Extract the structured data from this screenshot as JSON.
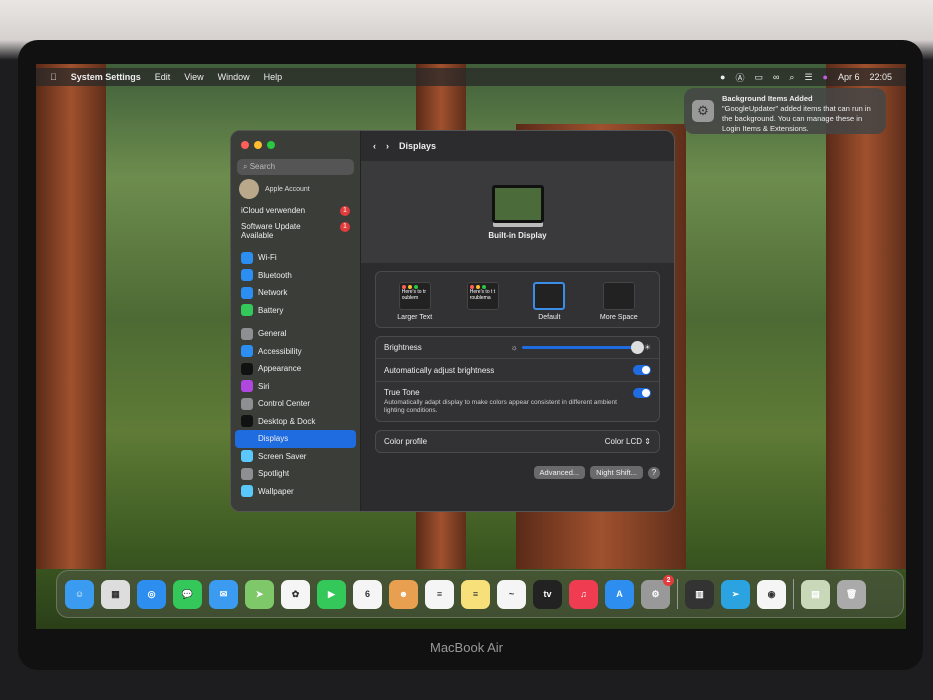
{
  "menubar": {
    "apple_icon": "apple-logo",
    "app": "System Settings",
    "items": [
      "Edit",
      "View",
      "Window",
      "Help"
    ],
    "status_icons": [
      "user-icon",
      "input-a-icon",
      "battery-icon",
      "link-icon",
      "search-icon",
      "control-center-icon",
      "siri-icon"
    ],
    "date": "Apr 6",
    "time": "22:05"
  },
  "notification": {
    "title": "Background Items Added",
    "body": "\"GoogleUpdater\" added items that can run in the background. You can manage these in Login Items & Extensions."
  },
  "sidebar": {
    "search_placeholder": "Search",
    "account_label": "Apple Account",
    "alerts": [
      {
        "label": "iCloud verwenden",
        "badge": "1"
      },
      {
        "label": "Software Update Available",
        "badge": "1"
      }
    ],
    "groups": [
      [
        {
          "label": "Wi-Fi",
          "icon": "wifi-icon",
          "color": "#2b8ef0"
        },
        {
          "label": "Bluetooth",
          "icon": "bluetooth-icon",
          "color": "#2b8ef0"
        },
        {
          "label": "Network",
          "icon": "globe-icon",
          "color": "#2b8ef0"
        },
        {
          "label": "Battery",
          "icon": "battery-icon",
          "color": "#34c759"
        }
      ],
      [
        {
          "label": "General",
          "icon": "gear-icon",
          "color": "#8e8e93"
        },
        {
          "label": "Accessibility",
          "icon": "accessibility-icon",
          "color": "#2b8ef0"
        },
        {
          "label": "Appearance",
          "icon": "appearance-icon",
          "color": "#111111"
        },
        {
          "label": "Siri",
          "icon": "siri-icon",
          "color": "#b048e0"
        },
        {
          "label": "Control Center",
          "icon": "control-center-icon",
          "color": "#8e8e93"
        },
        {
          "label": "Desktop & Dock",
          "icon": "dock-icon",
          "color": "#111111"
        },
        {
          "label": "Displays",
          "icon": "sun-icon",
          "color": "#1f6ce0",
          "selected": true
        },
        {
          "label": "Screen Saver",
          "icon": "screensaver-icon",
          "color": "#5ac8fa"
        },
        {
          "label": "Spotlight",
          "icon": "spotlight-icon",
          "color": "#8e8e93"
        },
        {
          "label": "Wallpaper",
          "icon": "wallpaper-icon",
          "color": "#5ac8fa"
        }
      ]
    ]
  },
  "main": {
    "title": "Displays",
    "display_name": "Built-in Display",
    "resolutions": [
      {
        "label": "Larger Text",
        "preview": "Here's to troublem"
      },
      {
        "label": "",
        "preview": "Here's to t troublema"
      },
      {
        "label": "Default",
        "selected": true,
        "preview": ""
      },
      {
        "label": "More Space",
        "preview": ""
      }
    ],
    "brightness_label": "Brightness",
    "brightness_value": 0.95,
    "auto_brightness_label": "Automatically adjust brightness",
    "auto_brightness_on": true,
    "true_tone_label": "True Tone",
    "true_tone_desc": "Automatically adapt display to make colors appear consistent in different ambient lighting conditions.",
    "true_tone_on": true,
    "color_profile_label": "Color profile",
    "color_profile_value": "Color LCD",
    "advanced_button": "Advanced...",
    "night_shift_button": "Night Shift...",
    "help_button": "?"
  },
  "dock": {
    "apps": [
      {
        "name": "Finder",
        "color": "#3a9bf0",
        "glyph": "☺"
      },
      {
        "name": "Launchpad",
        "color": "#ddd",
        "glyph": "▦"
      },
      {
        "name": "Safari",
        "color": "#2d8ef0",
        "glyph": "◎"
      },
      {
        "name": "Messages",
        "color": "#34c759",
        "glyph": "💬"
      },
      {
        "name": "Mail",
        "color": "#3a9bf0",
        "glyph": "✉"
      },
      {
        "name": "Maps",
        "color": "#7ec86a",
        "glyph": "➤"
      },
      {
        "name": "Photos",
        "color": "#f5f5f5",
        "glyph": "✿"
      },
      {
        "name": "FaceTime",
        "color": "#34c759",
        "glyph": "▶"
      },
      {
        "name": "Calendar",
        "color": "#f5f5f5",
        "glyph": "6"
      },
      {
        "name": "Contacts",
        "color": "#e8a050",
        "glyph": "☻"
      },
      {
        "name": "Reminders",
        "color": "#f5f5f5",
        "glyph": "≡"
      },
      {
        "name": "Notes",
        "color": "#f7e07a",
        "glyph": "≡"
      },
      {
        "name": "Freeform",
        "color": "#f5f5f5",
        "glyph": "~"
      },
      {
        "name": "TV",
        "color": "#222",
        "glyph": "tv"
      },
      {
        "name": "Music",
        "color": "#f03c50",
        "glyph": "♫"
      },
      {
        "name": "App Store",
        "color": "#2d8ef0",
        "glyph": "A"
      },
      {
        "name": "System Settings",
        "color": "#999",
        "glyph": "⚙",
        "badge": "2"
      }
    ],
    "recent": [
      {
        "name": "Piano",
        "color": "#333",
        "glyph": "▥"
      },
      {
        "name": "Telegram",
        "color": "#2aa3e0",
        "glyph": "➢"
      },
      {
        "name": "Chrome",
        "color": "#f5f5f5",
        "glyph": "◉"
      }
    ],
    "extras": [
      {
        "name": "Downloads",
        "color": "#c8d8b8",
        "glyph": "▤"
      },
      {
        "name": "Trash",
        "color": "#aaa",
        "glyph": "🗑"
      }
    ]
  },
  "device_label": "MacBook Air"
}
